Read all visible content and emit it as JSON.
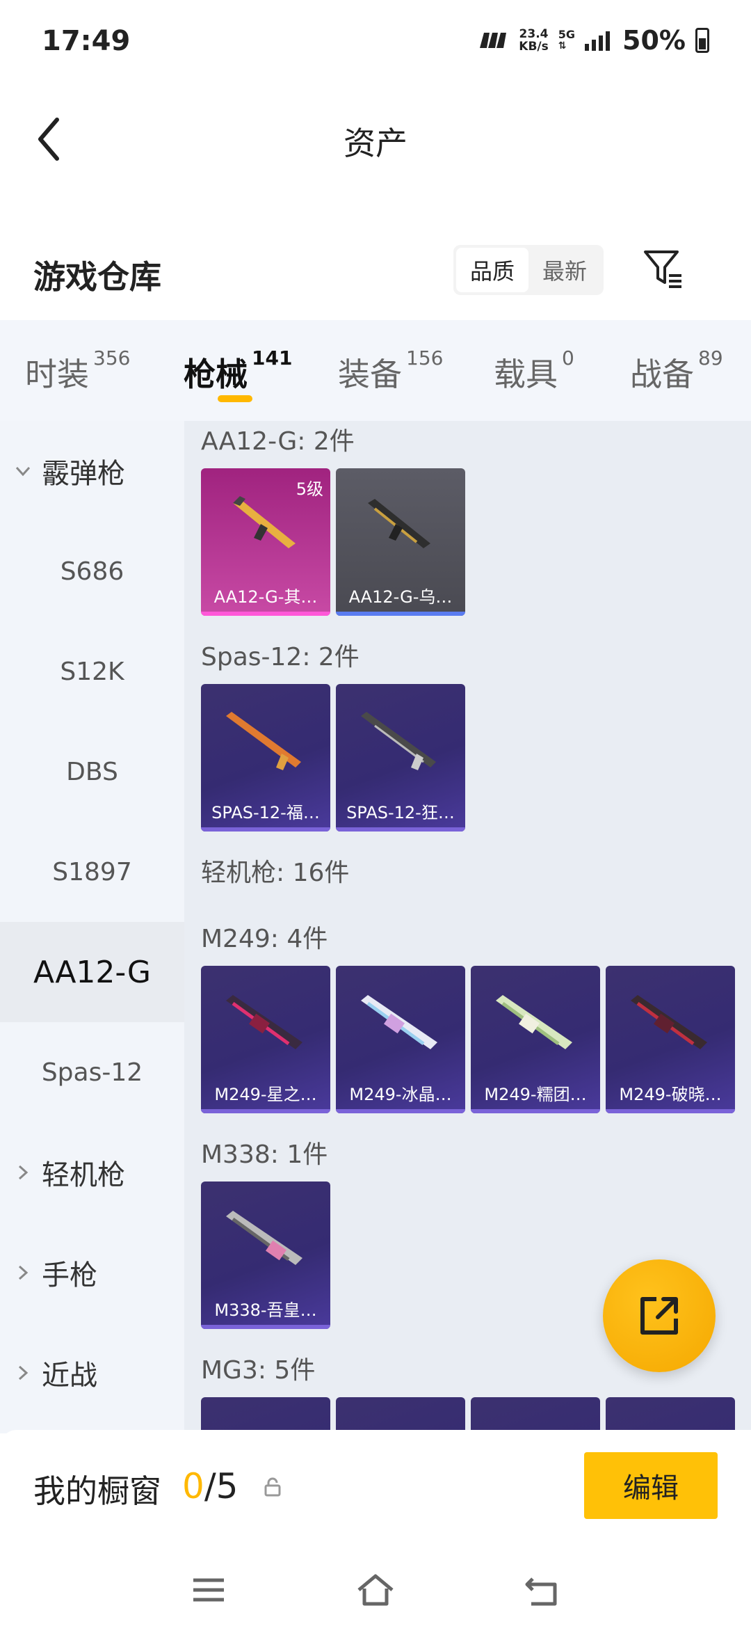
{
  "status": {
    "time": "17:49",
    "speed_top": "23.4",
    "speed_bottom": "KB/s",
    "network": "5G",
    "battery": "50%"
  },
  "header": {
    "title": "资产"
  },
  "warehouse": {
    "title": "游戏仓库",
    "sort_options": [
      "品质",
      "最新"
    ],
    "active_sort": "品质"
  },
  "tabs": [
    {
      "label": "时装",
      "count": "356"
    },
    {
      "label": "枪械",
      "count": "141"
    },
    {
      "label": "装备",
      "count": "156"
    },
    {
      "label": "载具",
      "count": "0"
    },
    {
      "label": "战备",
      "count": "89"
    }
  ],
  "active_tab": "枪械",
  "sidebar": {
    "items": [
      {
        "label": "霰弹枪",
        "type": "category",
        "expanded": true
      },
      {
        "label": "S686",
        "type": "item"
      },
      {
        "label": "S12K",
        "type": "item"
      },
      {
        "label": "DBS",
        "type": "item"
      },
      {
        "label": "S1897",
        "type": "item"
      },
      {
        "label": "AA12-G",
        "type": "item",
        "active": true
      },
      {
        "label": "Spas-12",
        "type": "item"
      },
      {
        "label": "轻机枪",
        "type": "category",
        "expanded": false
      },
      {
        "label": "手枪",
        "type": "category",
        "expanded": false
      },
      {
        "label": "近战",
        "type": "category",
        "expanded": false
      }
    ]
  },
  "content": {
    "groups": [
      {
        "label": "AA12-G: 2件",
        "cards": [
          {
            "name": "AA12-G-其…",
            "badge": "5级",
            "style": "pink"
          },
          {
            "name": "AA12-G-乌…",
            "style": "gray"
          }
        ]
      },
      {
        "label": "Spas-12: 2件",
        "cards": [
          {
            "name": "SPAS-12-福…",
            "style": "purple"
          },
          {
            "name": "SPAS-12-狂…",
            "style": "purple"
          }
        ]
      },
      {
        "label": "轻机枪: 16件"
      },
      {
        "label": "M249: 4件",
        "cards": [
          {
            "name": "M249-星之…",
            "style": "purple"
          },
          {
            "name": "M249-冰晶…",
            "style": "purple"
          },
          {
            "name": "M249-糯团…",
            "style": "purple"
          },
          {
            "name": "M249-破晓…",
            "style": "purple"
          }
        ]
      },
      {
        "label": "M338: 1件",
        "cards": [
          {
            "name": "M338-吾皇…",
            "style": "purple"
          }
        ]
      },
      {
        "label": "MG3: 5件"
      }
    ]
  },
  "showcase": {
    "label": "我的橱窗",
    "current": "0",
    "total": "/5",
    "edit_label": "编辑"
  },
  "colors": {
    "accent": "#ffb800",
    "card_purple": "#3c3170",
    "card_pink": "#c84aa5"
  },
  "icons": {
    "back": "back-arrow-icon",
    "filter": "filter-icon",
    "share": "share-icon",
    "lock": "lock-icon"
  }
}
